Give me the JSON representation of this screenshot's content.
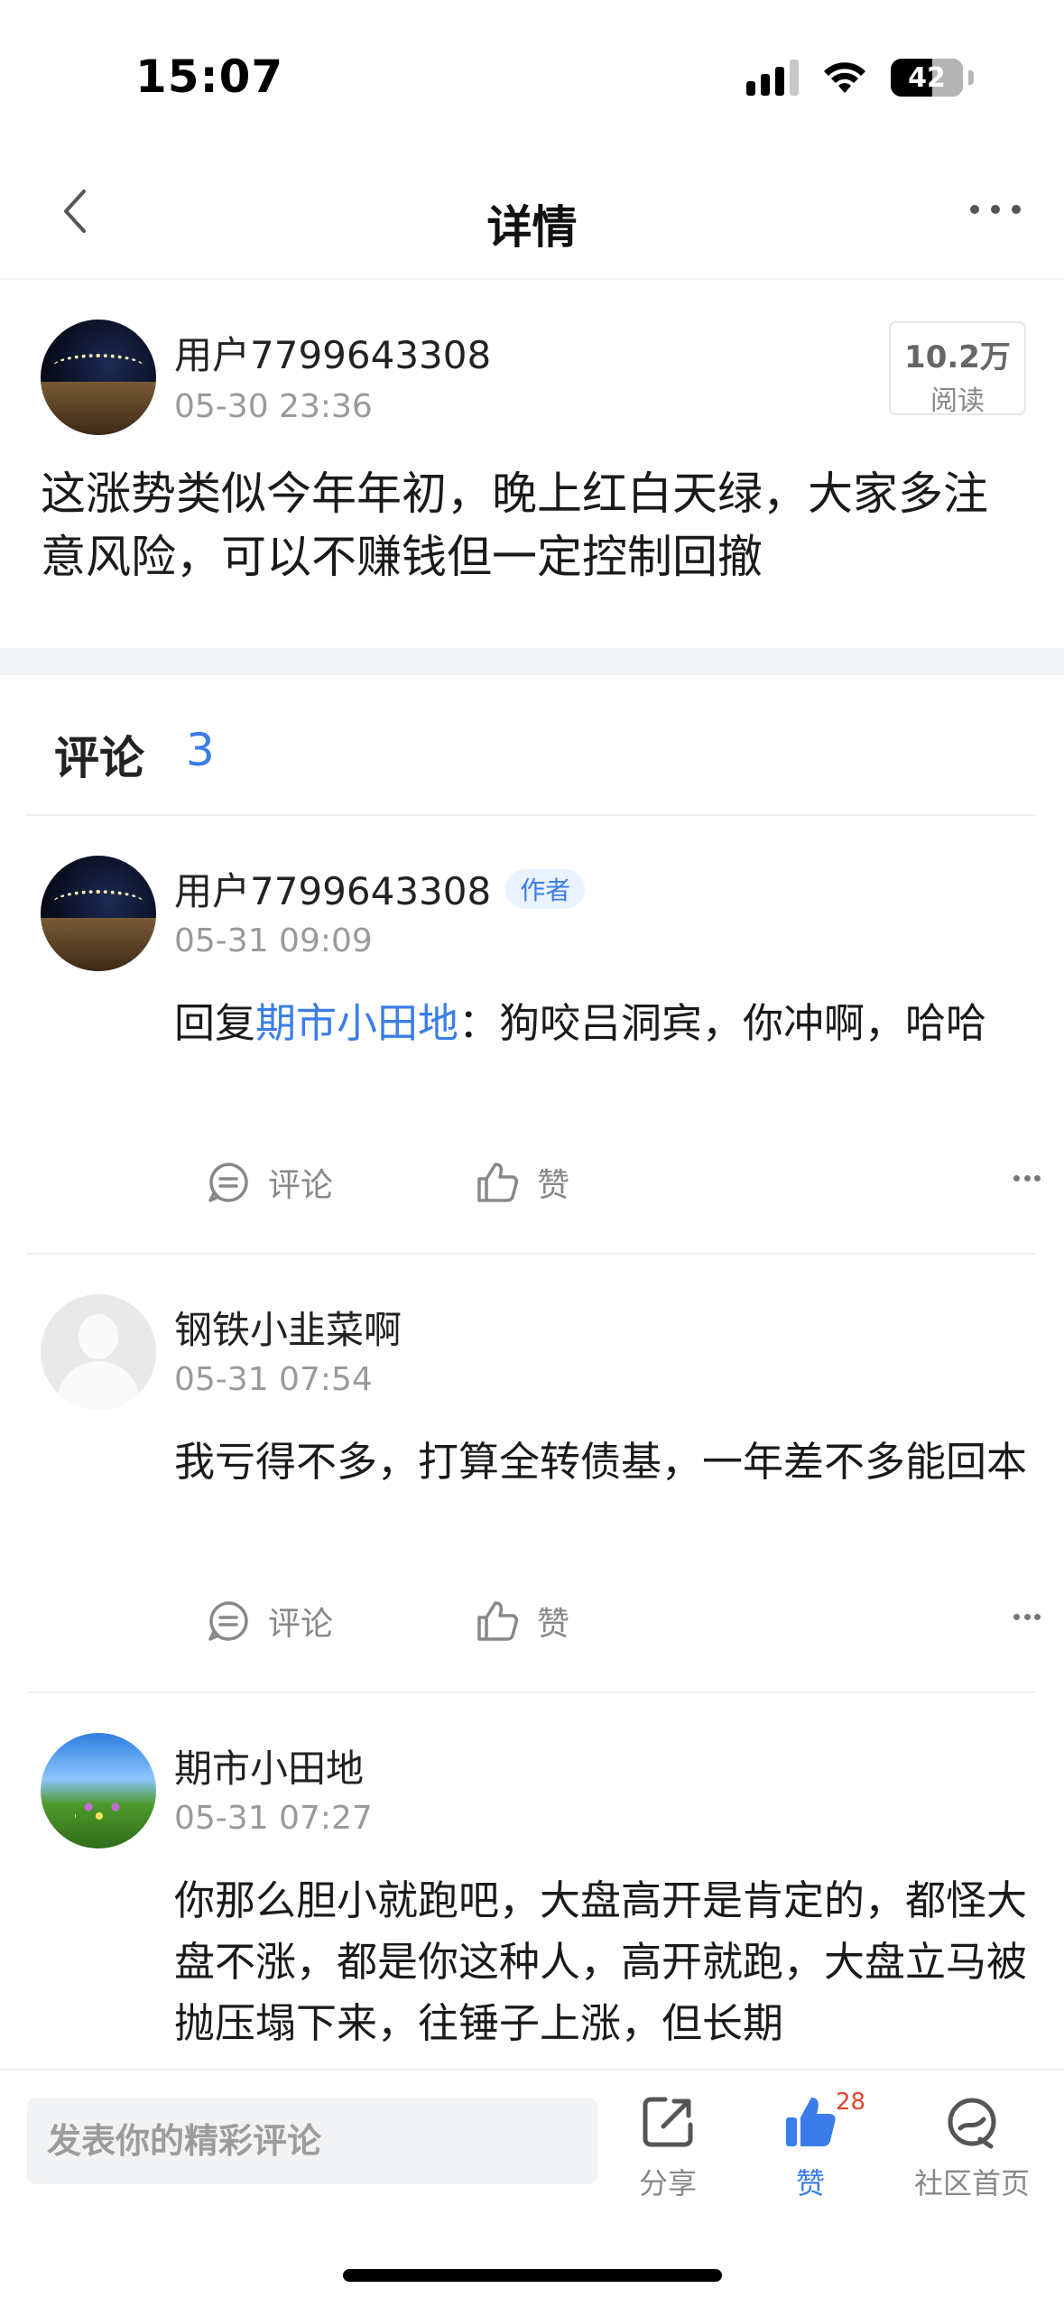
{
  "status_bar": {
    "time": "15:07",
    "battery": "42"
  },
  "nav": {
    "title": "详情"
  },
  "post": {
    "author": "用户7799643308",
    "time": "05-30 23:36",
    "reads_count": "10.2万",
    "reads_label": "阅读",
    "content": "这涨势类似今年年初，晚上红白天绿，大家多注意风险，可以不赚钱但一定控制回撤"
  },
  "comments_header": {
    "title": "评论",
    "count": "3"
  },
  "comments": [
    {
      "author": "用户7799643308",
      "badge": "作者",
      "time": "05-31 09:09",
      "reply_prefix": "回复",
      "reply_to": "期市小田地",
      "text": "：狗咬吕洞宾，你冲啊，哈哈",
      "comment_label": "评论",
      "like_label": "赞"
    },
    {
      "author": "钢铁小韭菜啊",
      "time": "05-31 07:54",
      "text": "我亏得不多，打算全转债基，一年差不多能回本",
      "comment_label": "评论",
      "like_label": "赞"
    },
    {
      "author": "期市小田地",
      "time": "05-31 07:27",
      "text": "你那么胆小就跑吧，大盘高开是肯定的，都怪大盘不涨，都是你这种人，高开就跑，大盘立马被抛压塌下来，往锤子上涨，但长期"
    }
  ],
  "bottom_bar": {
    "input_placeholder": "发表你的精彩评论",
    "share_label": "分享",
    "like_label": "赞",
    "like_count": "28",
    "home_label": "社区首页"
  },
  "colors": {
    "accent": "#3a7de8",
    "badge_red": "#e8422f"
  }
}
